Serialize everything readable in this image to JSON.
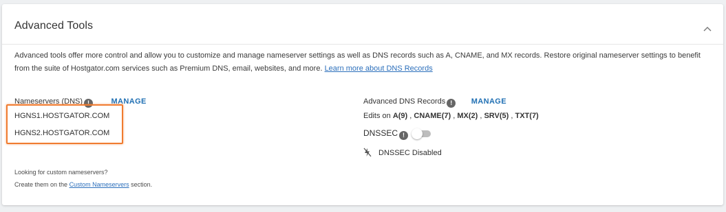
{
  "card": {
    "title": "Advanced Tools",
    "description": "Advanced tools offer more control and allow you to customize and manage nameserver settings as well as DNS records such as A, CNAME, and MX records. Restore original nameserver settings to benefit from the suite of Hostgator.com services such as Premium DNS, email, websites, and more.",
    "learn_more_link": "Learn more about DNS Records"
  },
  "nameservers": {
    "label": "Nameservers (DNS)",
    "info_glyph": "!",
    "manage_label": "MANAGE",
    "items": [
      "HGNS1.HOSTGATOR.COM",
      "HGNS2.HOSTGATOR.COM"
    ]
  },
  "dns_records": {
    "label": "Advanced DNS Records",
    "info_glyph": "!",
    "manage_label": "MANAGE",
    "edits_prefix": "Edits on",
    "edits": [
      "A(9)",
      "CNAME(7)",
      "MX(2)",
      "SRV(5)",
      "TXT(7)"
    ],
    "separator": " , "
  },
  "dnssec": {
    "label": "DNSSEC",
    "info_glyph": "!",
    "enabled": false,
    "status_text": "DNSSEC Disabled"
  },
  "custom_ns": {
    "line1": "Looking for custom nameservers?",
    "line2_prefix": "Create them on the",
    "line2_link": "Custom Nameservers",
    "line2_suffix": "section."
  },
  "colors": {
    "accent": "#1f6fb3",
    "highlight": "#f07b2f",
    "info_badge": "#666666"
  }
}
